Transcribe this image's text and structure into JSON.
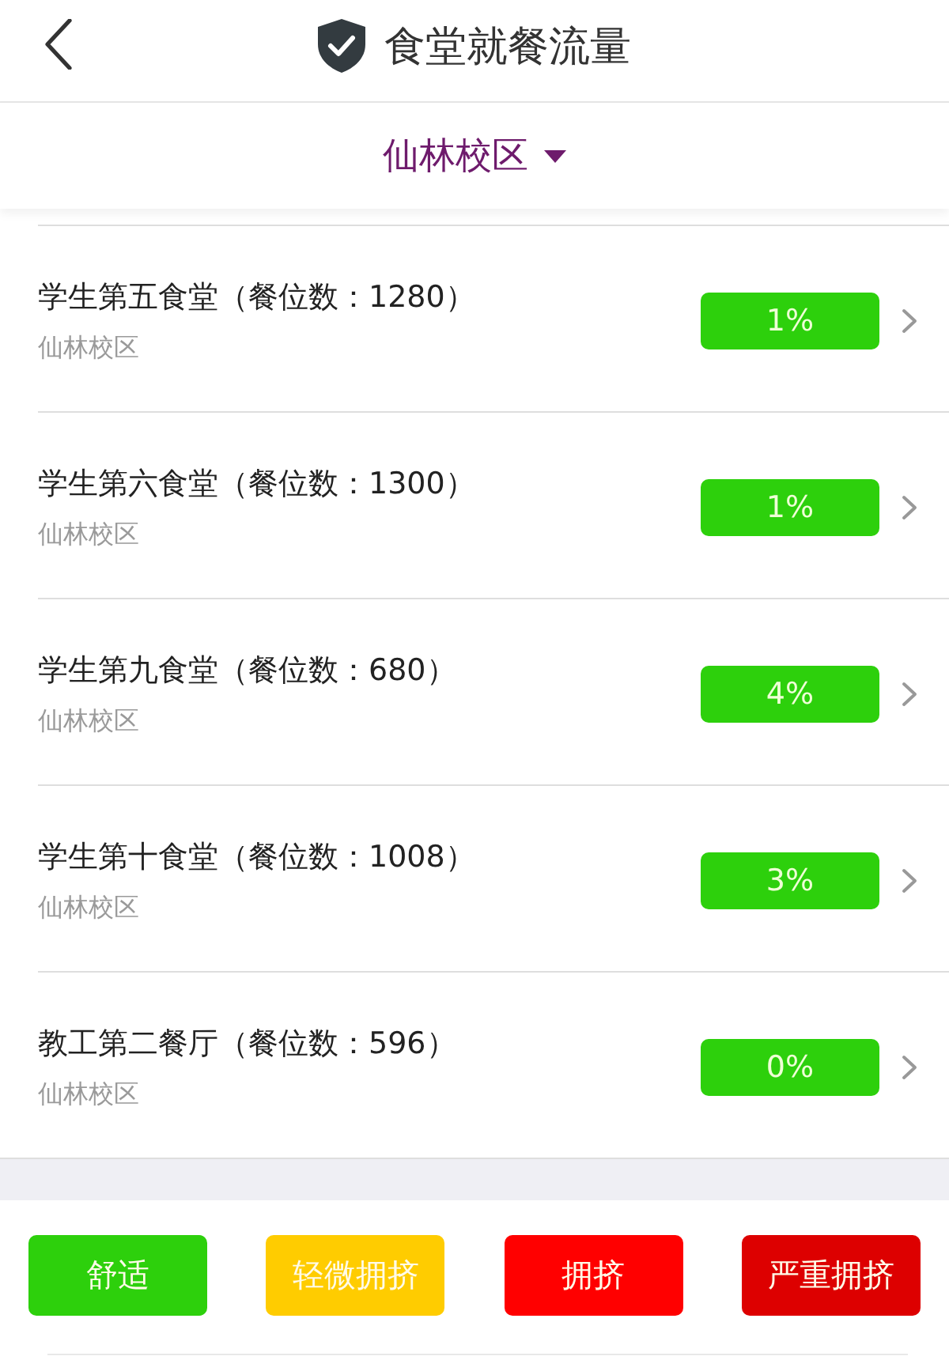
{
  "header": {
    "title": "食堂就餐流量"
  },
  "campus_selector": {
    "label": "仙林校区"
  },
  "canteens": [
    {
      "name": "学生第五食堂（餐位数：1280）",
      "campus": "仙林校区",
      "occupancy": "1%",
      "color": "#2dd00c"
    },
    {
      "name": "学生第六食堂（餐位数：1300）",
      "campus": "仙林校区",
      "occupancy": "1%",
      "color": "#2dd00c"
    },
    {
      "name": "学生第九食堂（餐位数：680）",
      "campus": "仙林校区",
      "occupancy": "4%",
      "color": "#2dd00c"
    },
    {
      "name": "学生第十食堂（餐位数：1008）",
      "campus": "仙林校区",
      "occupancy": "3%",
      "color": "#2dd00c"
    },
    {
      "name": "教工第二餐厅（餐位数：596）",
      "campus": "仙林校区",
      "occupancy": "0%",
      "color": "#2dd00c"
    }
  ],
  "legend": [
    {
      "label": "舒适",
      "color": "#2dd00c"
    },
    {
      "label": "轻微拥挤",
      "color": "#ffcc00"
    },
    {
      "label": "拥挤",
      "color": "#ff0000"
    },
    {
      "label": "严重拥挤",
      "color": "#dd0000"
    }
  ]
}
